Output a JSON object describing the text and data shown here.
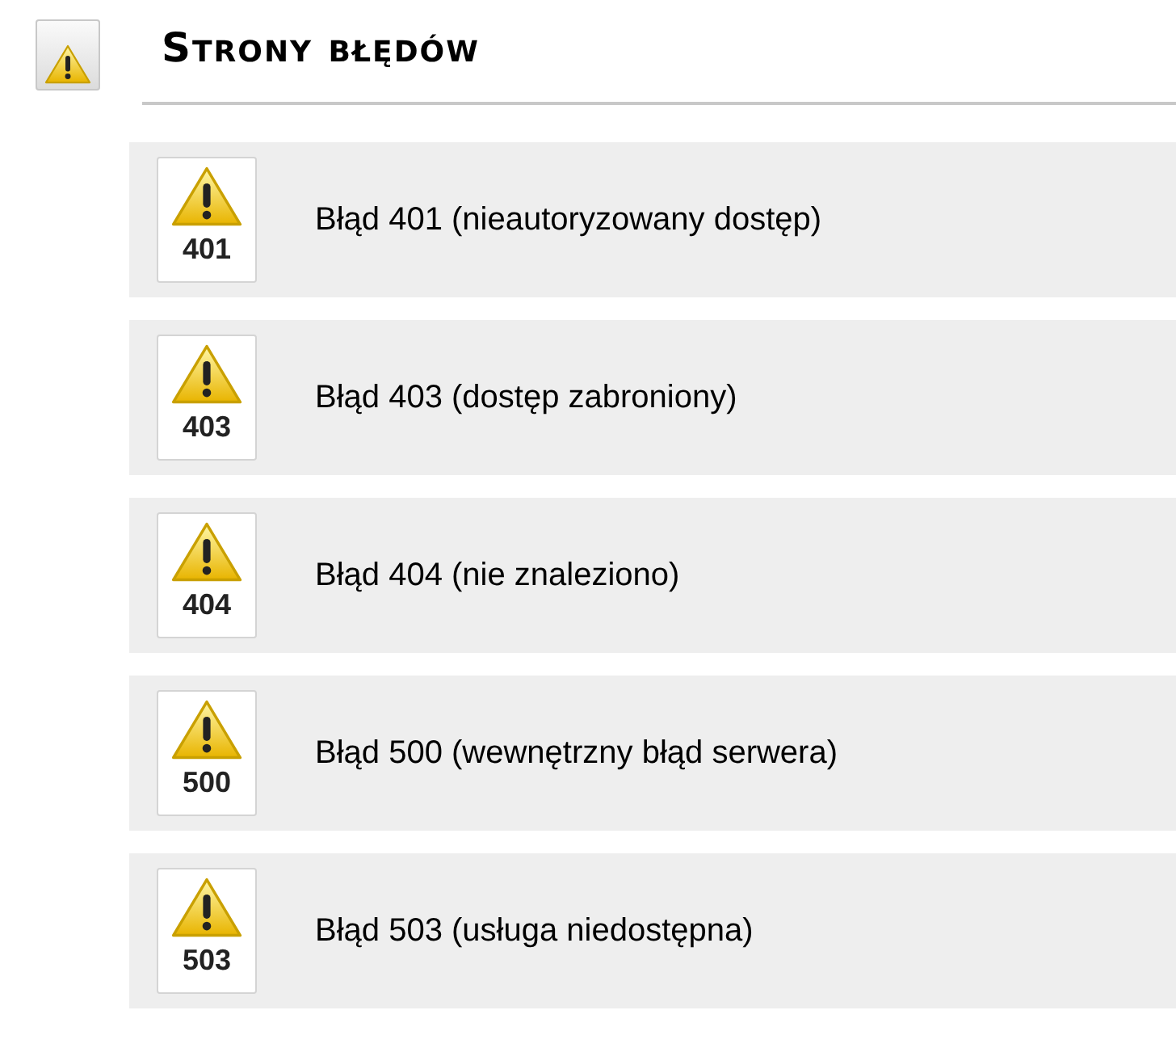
{
  "header": {
    "title": "Strony błędów"
  },
  "items": [
    {
      "code": "401",
      "label": "Błąd 401 (nieautoryzowany dostęp)"
    },
    {
      "code": "403",
      "label": "Błąd 403 (dostęp zabroniony)"
    },
    {
      "code": "404",
      "label": "Błąd 404 (nie znaleziono)"
    },
    {
      "code": "500",
      "label": "Błąd 500 (wewnętrzny błąd serwera)"
    },
    {
      "code": "503",
      "label": "Błąd 503 (usługa niedostępna)"
    }
  ]
}
